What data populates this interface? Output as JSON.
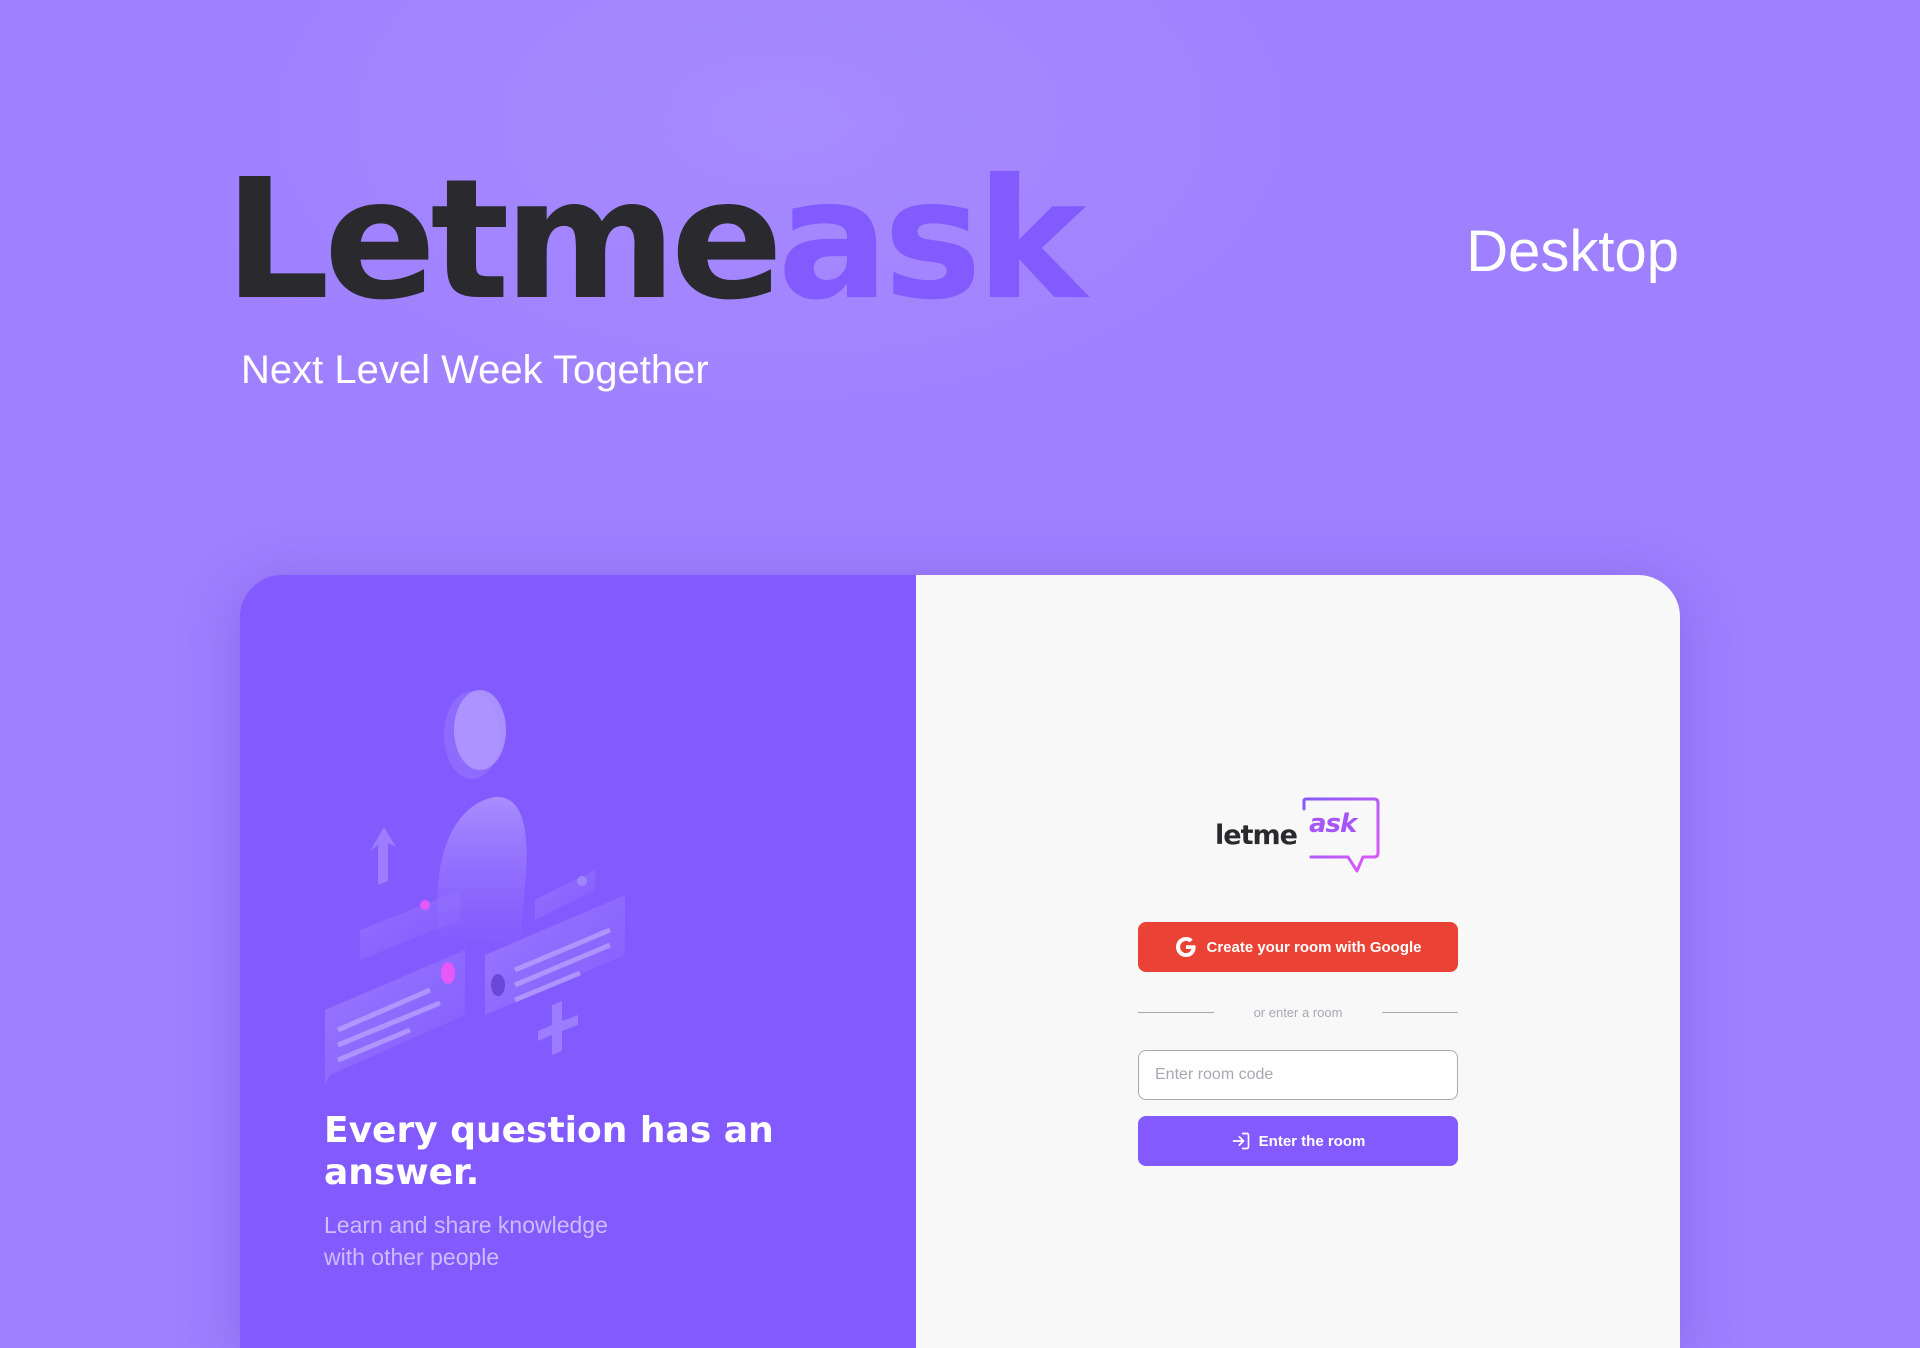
{
  "hero": {
    "brand_dark": "Letme",
    "brand_accent": "ask",
    "tagline": "Next Level Week Together",
    "platform": "Desktop"
  },
  "aside": {
    "illustration": "question-and-answer-illustration",
    "heading": "Every question has an answer.",
    "subtitle": "Learn and share knowledge with other people"
  },
  "main": {
    "logo": {
      "letme": "letme",
      "ask": "ask"
    },
    "google_button_label": "Create your room with Google",
    "google_icon": "google-icon",
    "separator_text": "or enter a room",
    "room_input": {
      "placeholder": "Enter room code",
      "value": ""
    },
    "enter_button_label": "Enter the room",
    "enter_icon": "log-in-icon"
  },
  "colors": {
    "background": "#9f80ff",
    "purple": "#835afd",
    "dark": "#29292e",
    "google_red": "#ea4335",
    "panel": "#f8f8f8",
    "muted": "#a8a8b3"
  }
}
